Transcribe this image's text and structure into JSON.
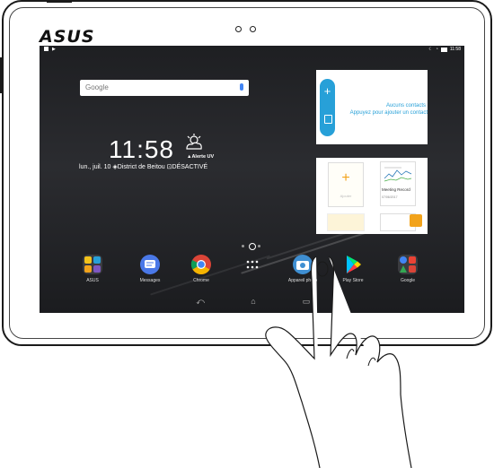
{
  "device": {
    "brand": "ASUS"
  },
  "statusbar": {
    "time": "11:58"
  },
  "search": {
    "label": "Google",
    "icon": "mic-icon"
  },
  "clock": {
    "time": "11:58",
    "alert": "▲Alerte UV",
    "date": "lun., juil. 10",
    "location": "District de Beitou",
    "alarm": "DÉSACTIVÉ"
  },
  "contacts_widget": {
    "title": "Aucuns contacts",
    "subtitle": "Appuyez pour ajouter un contact"
  },
  "notes_widget": {
    "add_label": "Ajouter",
    "record_title": "Meeting Record",
    "record_date": "07/06/2017"
  },
  "dock": [
    {
      "label": "ASUS",
      "icon": "asus-folder-icon"
    },
    {
      "label": "Messages",
      "icon": "messages-icon"
    },
    {
      "label": "Chrome",
      "icon": "chrome-icon"
    },
    {
      "label": "",
      "icon": "app-drawer-icon"
    },
    {
      "label": "Appareil photo",
      "icon": "camera-icon"
    },
    {
      "label": "Play Store",
      "icon": "play-store-icon"
    },
    {
      "label": "Google",
      "icon": "google-folder-icon"
    }
  ],
  "colors": {
    "accent_blue": "#27a0d8",
    "notes_orange": "#f2a31b",
    "wallpaper": "#232427"
  }
}
